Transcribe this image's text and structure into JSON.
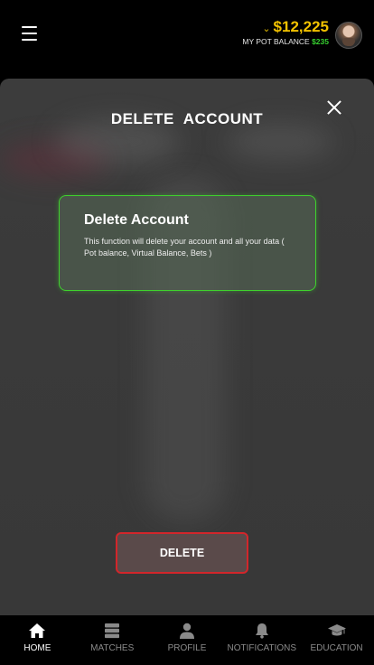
{
  "header": {
    "balance_amount": "$12,225",
    "pot_label": "MY POT BALANCE",
    "pot_value": "$235",
    "chevron_icon": "chevron-down-icon",
    "menu_icon": "hamburger-menu-icon"
  },
  "modal": {
    "title": "DELETE  ACCOUNT",
    "card_title": "Delete Account",
    "card_text": "This function will delete your account and all your data ( Pot balance, Virtual Balance, Bets )",
    "delete_label": "DELETE"
  },
  "nav": {
    "items": [
      {
        "label": "HOME",
        "icon": "home-icon",
        "active": true
      },
      {
        "label": "MATCHES",
        "icon": "server-stack-icon",
        "active": false
      },
      {
        "label": "PROFILE",
        "icon": "user-icon",
        "active": false
      },
      {
        "label": "NOTIFICATIONS",
        "icon": "bell-icon",
        "active": false
      },
      {
        "label": "EDUCATION",
        "icon": "graduation-cap-icon",
        "active": false
      }
    ]
  },
  "colors": {
    "accent_gold": "#f2c200",
    "pot_green": "#36d12f",
    "card_border": "#3fd22d",
    "danger": "#d2262b"
  }
}
